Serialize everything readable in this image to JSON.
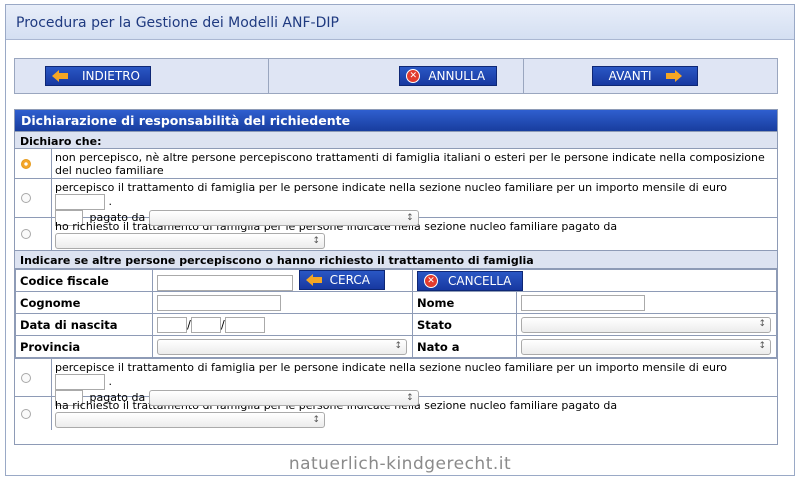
{
  "app": {
    "title": "Procedura per la Gestione dei Modelli ANF-DIP"
  },
  "nav": {
    "back_label": "INDIETRO",
    "cancel_label": "ANNULLA",
    "next_label": "AVANTI"
  },
  "section": {
    "title": "Dichiarazione di responsabilità del richiedente",
    "declare_label": "Dichiaro che:",
    "options": [
      {
        "text": "non percepisco, nè altre persone percepiscono trattamenti di famiglia italiani o esteri per le persone indicate nella composizione del nucleo familiare",
        "checked": true
      },
      {
        "text": "percepisco il trattamento di famiglia per le persone indicate nella sezione nucleo familiare per un importo mensile di euro",
        "suffix": ".",
        "paid_label": "pagato da",
        "checked": false
      },
      {
        "text": "ho richiesto il trattamento di famiglia per le persone indicate nella sezione nucleo familiare pagato da",
        "checked": false
      }
    ],
    "others_label": "Indicare se altre persone percepiscono o hanno richiesto il trattamento di famiglia"
  },
  "form": {
    "codice_fiscale_label": "Codice fiscale",
    "search_label": "CERCA",
    "clear_label": "CANCELLA",
    "cognome_label": "Cognome",
    "nome_label": "Nome",
    "data_nascita_label": "Data di nascita",
    "date_sep": "/",
    "stato_label": "Stato",
    "provincia_label": "Provincia",
    "nato_a_label": "Nato a"
  },
  "others_options": [
    {
      "text": "percepisce il trattamento di famiglia per le persone indicate nella sezione nucleo familiare per un importo mensile di euro",
      "suffix": ".",
      "paid_label": "pagato da",
      "checked": false
    },
    {
      "text": "ha richiesto il trattamento di famiglia per le persone indicate nella sezione nucleo familiare pagato da",
      "checked": false
    }
  ],
  "watermark": "natuerlich-kindgerecht.it",
  "colors": {
    "header_blue": "#1f3a80",
    "button_blue": "#1738a0",
    "accent_orange": "#f5a623"
  }
}
